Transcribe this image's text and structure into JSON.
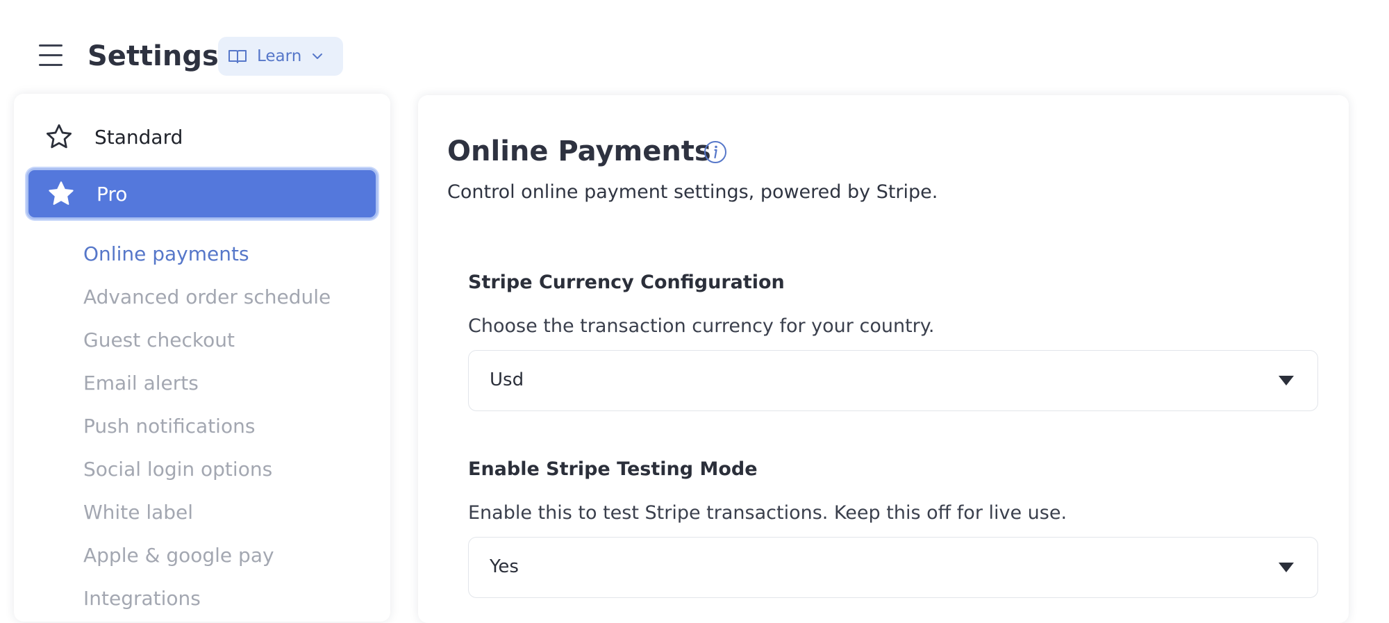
{
  "header": {
    "title": "Settings",
    "learn_label": "Learn"
  },
  "sidebar": {
    "tiers": [
      {
        "label": "Standard",
        "icon": "star-outline-icon"
      },
      {
        "label": "Pro",
        "icon": "star-filled-icon"
      }
    ],
    "items": [
      {
        "label": "Online payments"
      },
      {
        "label": "Advanced order schedule"
      },
      {
        "label": "Guest checkout"
      },
      {
        "label": "Email alerts"
      },
      {
        "label": "Push notifications"
      },
      {
        "label": "Social login options"
      },
      {
        "label": "White label"
      },
      {
        "label": "Apple & google pay"
      },
      {
        "label": "Integrations"
      }
    ],
    "active_item": "Online payments"
  },
  "main": {
    "title": "Online Payments",
    "description": "Control online payment settings, powered by Stripe.",
    "sections": [
      {
        "title": "Stripe Currency Configuration",
        "description": "Choose the transaction currency for your country.",
        "value": "Usd"
      },
      {
        "title": "Enable Stripe Testing Mode",
        "description": "Enable this to test Stripe transactions. Keep this off for live use.",
        "value": "Yes"
      }
    ]
  },
  "colors": {
    "accent": "#5478dc",
    "active_link": "#5677c9",
    "learn_bg": "#e9f0fb",
    "muted_text": "#a3a7b1"
  }
}
